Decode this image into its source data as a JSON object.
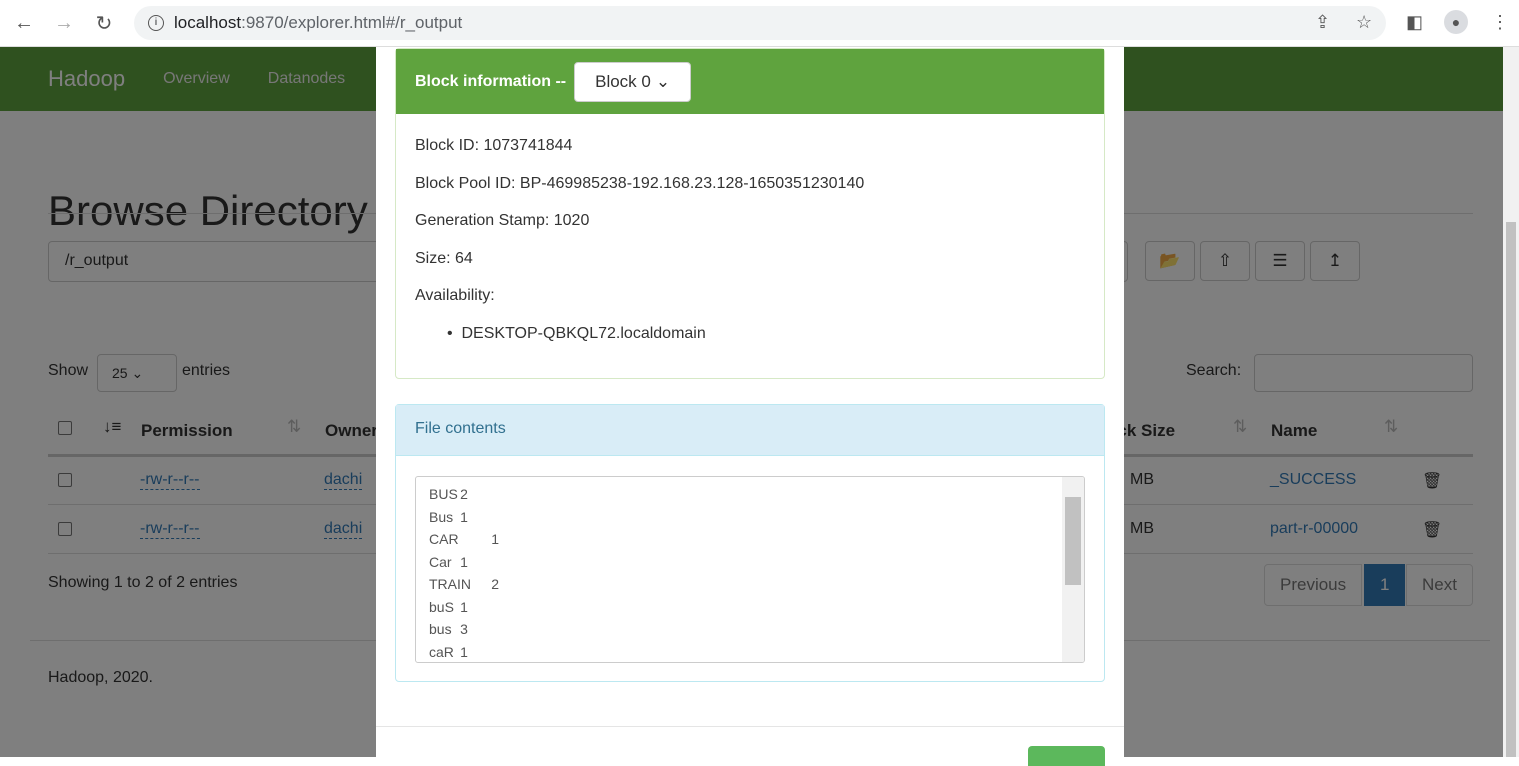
{
  "browser": {
    "url_host": "localhost",
    "url_path": ":9870/explorer.html#/r_output"
  },
  "navbar": {
    "brand": "Hadoop",
    "links": [
      "Overview",
      "Datanodes"
    ]
  },
  "page": {
    "title": "Browse Directory",
    "path": "/r_output",
    "show_label": "Show",
    "page_size": "25",
    "entries_label": "entries",
    "search_label": "Search:",
    "columns": {
      "permission": "Permission",
      "owner": "Owner",
      "block_size": "Block Size",
      "name": "Name"
    },
    "rows": [
      {
        "permission": "-rw-r--r--",
        "owner": "dachi",
        "block_size": "MB",
        "name": "_SUCCESS"
      },
      {
        "permission": "-rw-r--r--",
        "owner": "dachi",
        "block_size": "MB",
        "name": "part-r-00000"
      }
    ],
    "showing": "Showing 1 to 2 of 2 entries",
    "pager": {
      "previous": "Previous",
      "current": "1",
      "next": "Next"
    },
    "footer": "Hadoop, 2020."
  },
  "modal": {
    "block_title": "Block information --",
    "block_select": "Block 0",
    "block_id": "Block ID: 1073741844",
    "pool_id": "Block Pool ID: BP-469985238-192.168.23.128-1650351230140",
    "gen_stamp": "Generation Stamp: 1020",
    "size": "Size: 64",
    "availability": "Availability:",
    "nodes": [
      "DESKTOP-QBKQL72.localdomain"
    ],
    "file_contents_title": "File contents",
    "file_lines": [
      "BUS\t2",
      "Bus\t1",
      "CAR\t1",
      "Car\t1",
      "TRAIN\t2",
      "buS\t1",
      "bus\t3",
      "caR\t1"
    ]
  }
}
